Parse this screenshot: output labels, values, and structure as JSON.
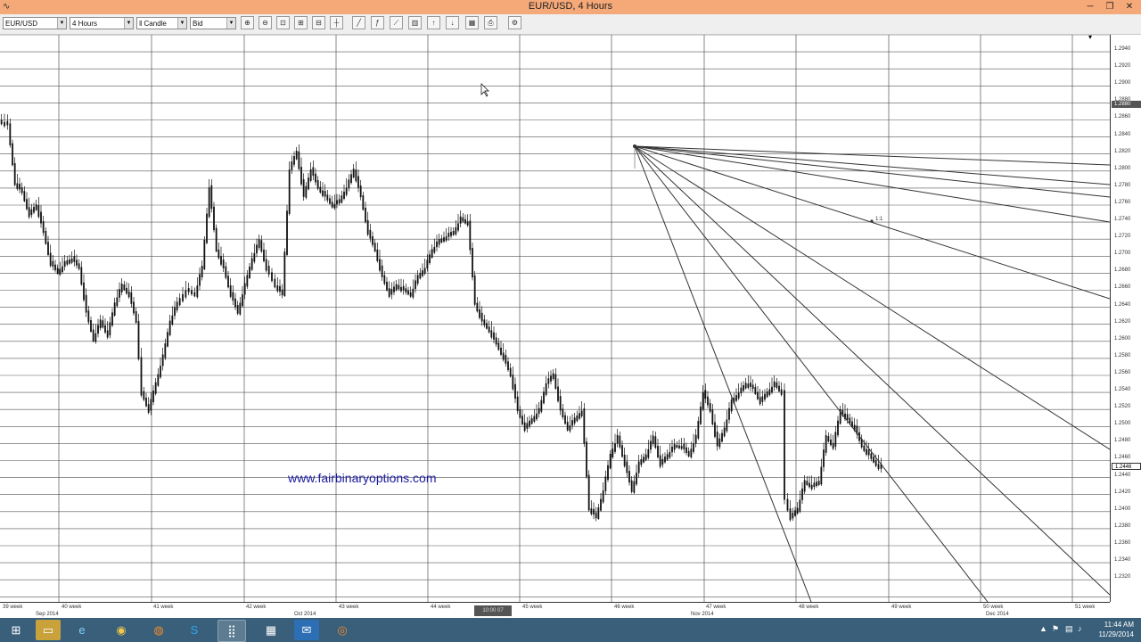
{
  "window": {
    "title": "EUR/USD, 4 Hours",
    "minimize": "─",
    "restore": "❐",
    "close": "✕",
    "app_icon": "chart-app-icon"
  },
  "toolbar": {
    "symbol": "EUR/USD",
    "timeframe": "4 Hours",
    "chart_type": "Candle",
    "price_side": "Bid",
    "buttons": [
      "zoom-in",
      "zoom-out",
      "zoom-fit",
      "zoom-range",
      "zoom-reset",
      "crosshair",
      "line-tool",
      "fibonacci-tool",
      "gann-fan-tool",
      "indicators",
      "trade-up",
      "trade-down",
      "grid-toggle",
      "print",
      "settings"
    ]
  },
  "watermark": "www.fairbinaryoptions.com",
  "chart": {
    "colors": {
      "grid": "#555555",
      "candle": "#111111",
      "fan": "#333333",
      "current_bg": "#000000"
    },
    "price_labels": [
      "1.2940",
      "1.2920",
      "1.2900",
      "1.2880",
      "1.2860",
      "1.2840",
      "1.2820",
      "1.2800",
      "1.2780",
      "1.2760",
      "1.2740",
      "1.2720",
      "1.2700",
      "1.2680",
      "1.2660",
      "1.2640",
      "1.2620",
      "1.2600",
      "1.2580",
      "1.2560",
      "1.2540",
      "1.2520",
      "1.2500",
      "1.2480",
      "1.2460",
      "1.2440",
      "1.2420",
      "1.2400",
      "1.2380",
      "1.2360",
      "1.2340",
      "1.2320"
    ],
    "current_bid": "1.2880",
    "current_price": "1.2446",
    "fan_label": "1:1",
    "week_labels": [
      "39 week",
      "40 week",
      "41 week",
      "42 week",
      "43 week",
      "44 week",
      "45 week",
      "46 week",
      "47 week",
      "48 week",
      "49 week",
      "50 week",
      "51 week"
    ],
    "month_labels": [
      "Sep 2014",
      "Oct 2014",
      "Nov 2014",
      "Dec 2014"
    ],
    "cursor_tag": "10:00 07"
  },
  "taskbar": {
    "icons": [
      "windows-start-icon",
      "file-explorer-icon",
      "internet-explorer-icon",
      "chrome-icon",
      "firefox-icon",
      "skype-icon",
      "trading-app-icon",
      "calculator-icon",
      "mail-icon",
      "media-player-icon"
    ],
    "time": "11:44 AM",
    "date": "11/29/2014"
  }
}
